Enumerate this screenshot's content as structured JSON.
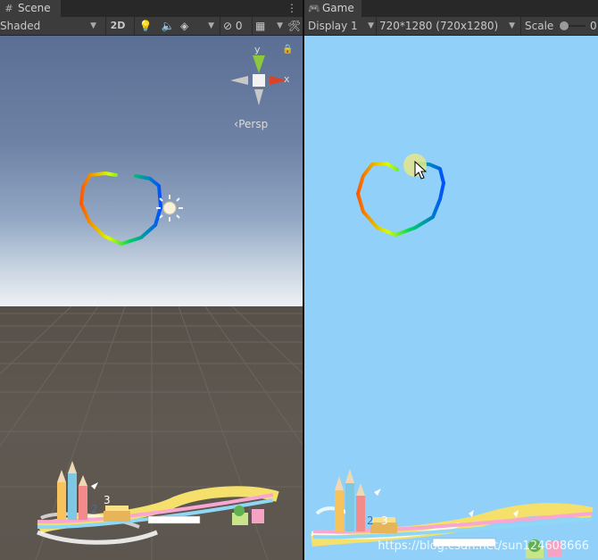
{
  "scene": {
    "tab_label": "Scene",
    "tab_icon": "grid-icon",
    "more_icon": "vertical-ellipsis-icon",
    "shading_mode": "Shaded",
    "toggle_2d_label": "2D",
    "hidden_count": "0",
    "gizmo": {
      "y_label": "y",
      "x_label": "x",
      "projection_label": "Persp"
    }
  },
  "game": {
    "tab_label": "Game",
    "tab_icon": "gamepad-icon",
    "display_label": "Display 1",
    "resolution_label": "720*1280 (720x1280)",
    "scale_label": "Scale",
    "scale_value": "0"
  },
  "watermark": "https://blog.csdn.net/sun124608666",
  "colors": {
    "sky_top": "#5a6f93",
    "horizon": "#eef1f4",
    "ground": "#5c564f",
    "game_bg": "#91d1f9",
    "tab_bg": "#3c3c3c"
  }
}
